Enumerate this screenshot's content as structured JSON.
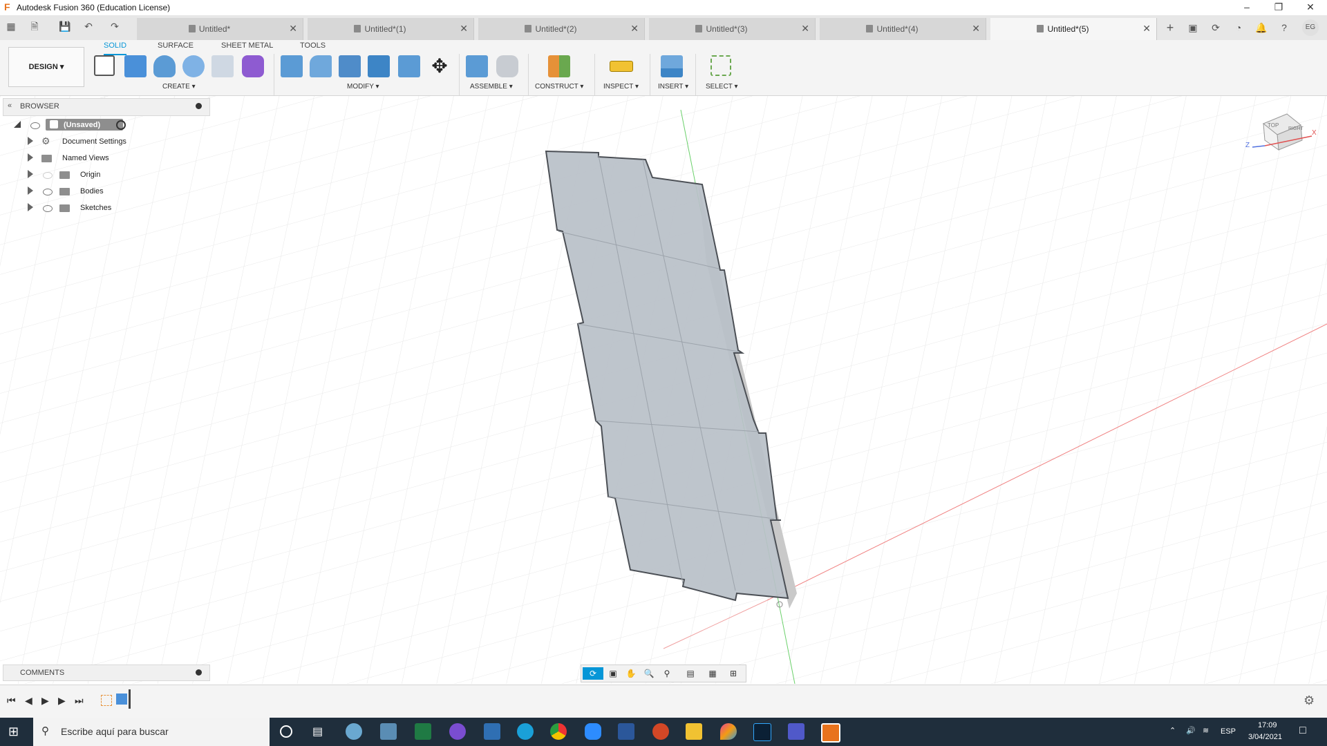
{
  "window": {
    "title": "Autodesk Fusion 360 (Education License)",
    "logo": "F"
  },
  "tabs": [
    {
      "label": "Untitled*",
      "active": false
    },
    {
      "label": "Untitled*(1)",
      "active": false
    },
    {
      "label": "Untitled*(2)",
      "active": false
    },
    {
      "label": "Untitled*(3)",
      "active": false
    },
    {
      "label": "Untitled*(4)",
      "active": false
    },
    {
      "label": "Untitled*(5)",
      "active": true
    }
  ],
  "user": {
    "initials": "EG"
  },
  "toolbar": {
    "workspace": "DESIGN",
    "tabs": [
      "SOLID",
      "SURFACE",
      "SHEET METAL",
      "TOOLS"
    ],
    "groups": [
      "CREATE",
      "MODIFY",
      "ASSEMBLE",
      "CONSTRUCT",
      "INSPECT",
      "INSERT",
      "SELECT"
    ]
  },
  "browser": {
    "title": "BROWSER",
    "root": "(Unsaved)",
    "items": [
      "Document Settings",
      "Named Views",
      "Origin",
      "Bodies",
      "Sketches"
    ]
  },
  "viewcube": {
    "top": "TOP",
    "right": "RIGHT",
    "x": "X",
    "z": "Z"
  },
  "comments": {
    "title": "COMMENTS"
  },
  "taskbar": {
    "search_placeholder": "Escribe aquí para buscar",
    "language": "ESP",
    "time": "17:09",
    "date": "3/04/2021"
  },
  "colors": {
    "accent": "#0696d7",
    "taskbar": "#1f2e3c",
    "body_fill": "#b9c0c8"
  }
}
